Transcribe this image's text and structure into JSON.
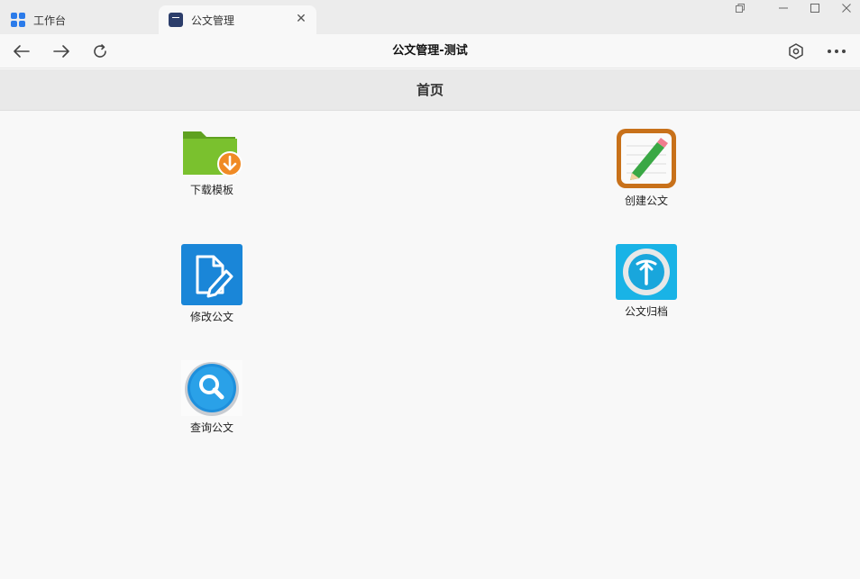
{
  "tabs": [
    {
      "label": "工作台",
      "icon": "grid-icon"
    },
    {
      "label": "公文管理",
      "icon": "document-app-icon"
    }
  ],
  "window_controls": [
    "restore-pages-icon",
    "minimize-icon",
    "maximize-icon",
    "close-icon"
  ],
  "toolbar": {
    "title": "公文管理-测试",
    "icons": [
      "back-arrow-icon",
      "forward-arrow-icon",
      "refresh-icon",
      "settings-hex-icon",
      "more-icon"
    ]
  },
  "header": {
    "title": "首页"
  },
  "apps": [
    {
      "label": "下载模板",
      "icon": "folder-download-icon"
    },
    {
      "label": "创建公文",
      "icon": "pencil-notepad-icon"
    },
    {
      "label": "修改公文",
      "icon": "edit-document-icon"
    },
    {
      "label": "公文归档",
      "icon": "archive-upload-icon"
    },
    {
      "label": "查询公文",
      "icon": "magnifier-icon"
    }
  ],
  "colors": {
    "accent_blue": "#2b7bea",
    "folder_green": "#7ac12e",
    "download_orange": "#f08a24",
    "pencil_frame": "#c8711a",
    "edit_blue": "#1a86d8",
    "archive_blue": "#19b3e6"
  }
}
